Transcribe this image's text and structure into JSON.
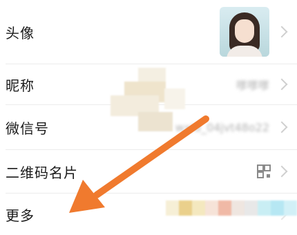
{
  "rows": {
    "avatar": {
      "label": "头像"
    },
    "nickname": {
      "label": "昵称",
      "value": "嗲嗲嗲"
    },
    "wechat_id": {
      "label": "微信号",
      "value": "wxid_04jvt48o22"
    },
    "qr_code": {
      "label": "二维码名片"
    },
    "more": {
      "label": "更多"
    }
  },
  "icons": {
    "avatar_image": "avatar-photo",
    "qr": "qr-code-icon",
    "chevron": "chevron-right-icon",
    "arrow": "orange-arrow-annotation"
  },
  "colors": {
    "label": "#1a1a1a",
    "value": "#b2b2b2",
    "divider": "#ececec",
    "chevron": "#cfcfcf",
    "arrow": "#f07a2e"
  }
}
